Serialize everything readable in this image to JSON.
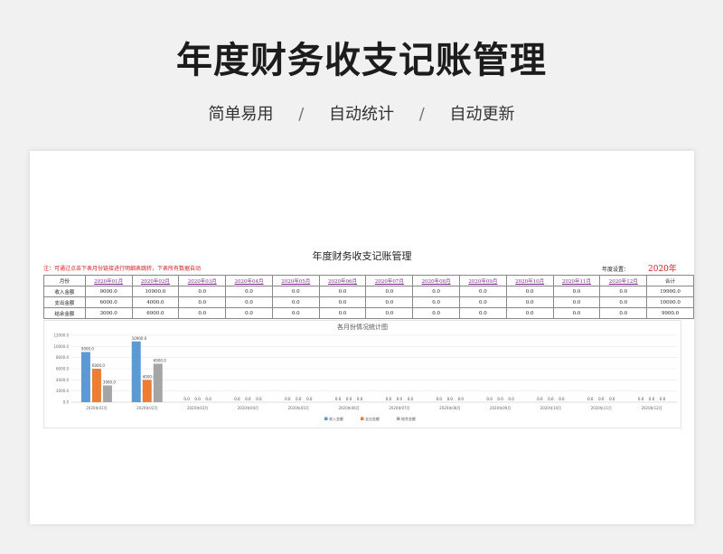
{
  "hero": {
    "title": "年度财务收支记账管理",
    "features": [
      "简单易用",
      "自动统计",
      "自动更新"
    ],
    "separator": "/"
  },
  "sheet": {
    "title": "年度财务收支记账管理",
    "note": "注：可通过点击下表月份链接进行明细表跳转，下表所有数据自动",
    "year_label": "年度设置：",
    "year_value": "2020年",
    "table": {
      "headers": [
        "月份",
        "2020年01月",
        "2020年02月",
        "2020年03月",
        "2020年04月",
        "2020年05月",
        "2020年06月",
        "2020年07月",
        "2020年08月",
        "2020年09月",
        "2020年10月",
        "2020年11月",
        "2020年12月",
        "合计"
      ],
      "rows": [
        [
          "收入金额",
          "9000.0",
          "10900.0",
          "0.0",
          "0.0",
          "0.0",
          "0.0",
          "0.0",
          "0.0",
          "0.0",
          "0.0",
          "0.0",
          "0.0",
          "19900.0"
        ],
        [
          "支出金额",
          "6000.0",
          "4000.0",
          "0.0",
          "0.0",
          "0.0",
          "0.0",
          "0.0",
          "0.0",
          "0.0",
          "0.0",
          "0.0",
          "0.0",
          "10000.0"
        ],
        [
          "结余金额",
          "3000.0",
          "6900.0",
          "0.0",
          "0.0",
          "0.0",
          "0.0",
          "0.0",
          "0.0",
          "0.0",
          "0.0",
          "0.0",
          "0.0",
          "9900.0"
        ]
      ]
    }
  },
  "colors": {
    "income": "#5b9bd5",
    "expense": "#ed7d31",
    "balance": "#a5a5a5",
    "note_red": "#d02020",
    "link_purple": "#7b2a8a"
  },
  "chart_data": {
    "type": "bar",
    "title": "各月份情况统计图",
    "categories": [
      "2020年01月",
      "2020年02月",
      "2020年03月",
      "2020年04月",
      "2020年05月",
      "2020年06月",
      "2020年07月",
      "2020年08月",
      "2020年09月",
      "2020年10月",
      "2020年11月",
      "2020年12月"
    ],
    "series": [
      {
        "name": "收入金额",
        "values": [
          9000,
          10900,
          0,
          0,
          0,
          0,
          0,
          0,
          0,
          0,
          0,
          0
        ],
        "labels": [
          "9000.0",
          "10900.0",
          "0.0",
          "0.0",
          "0.0",
          "0.0",
          "0.0",
          "0.0",
          "0.0",
          "0.0",
          "0.0",
          "0.0"
        ]
      },
      {
        "name": "支出金额",
        "values": [
          6000,
          4000,
          0,
          0,
          0,
          0,
          0,
          0,
          0,
          0,
          0,
          0
        ],
        "labels": [
          "6000.0",
          "4000.0",
          "0.0",
          "0.0",
          "0.0",
          "0.0",
          "0.0",
          "0.0",
          "0.0",
          "0.0",
          "0.0",
          "0.0"
        ]
      },
      {
        "name": "结余金额",
        "values": [
          3000,
          6900,
          0,
          0,
          0,
          0,
          0,
          0,
          0,
          0,
          0,
          0
        ],
        "labels": [
          "3000.0",
          "6900.0",
          "0.0",
          "0.0",
          "0.0",
          "0.0",
          "0.0",
          "0.0",
          "0.0",
          "0.0",
          "0.0",
          "0.0"
        ]
      }
    ],
    "ylim": [
      0,
      12000
    ],
    "yticks": [
      "0.0",
      "2000.0",
      "4000.0",
      "6000.0",
      "8000.0",
      "10000.0",
      "12000.0"
    ],
    "grid": true,
    "legend_position": "bottom"
  }
}
